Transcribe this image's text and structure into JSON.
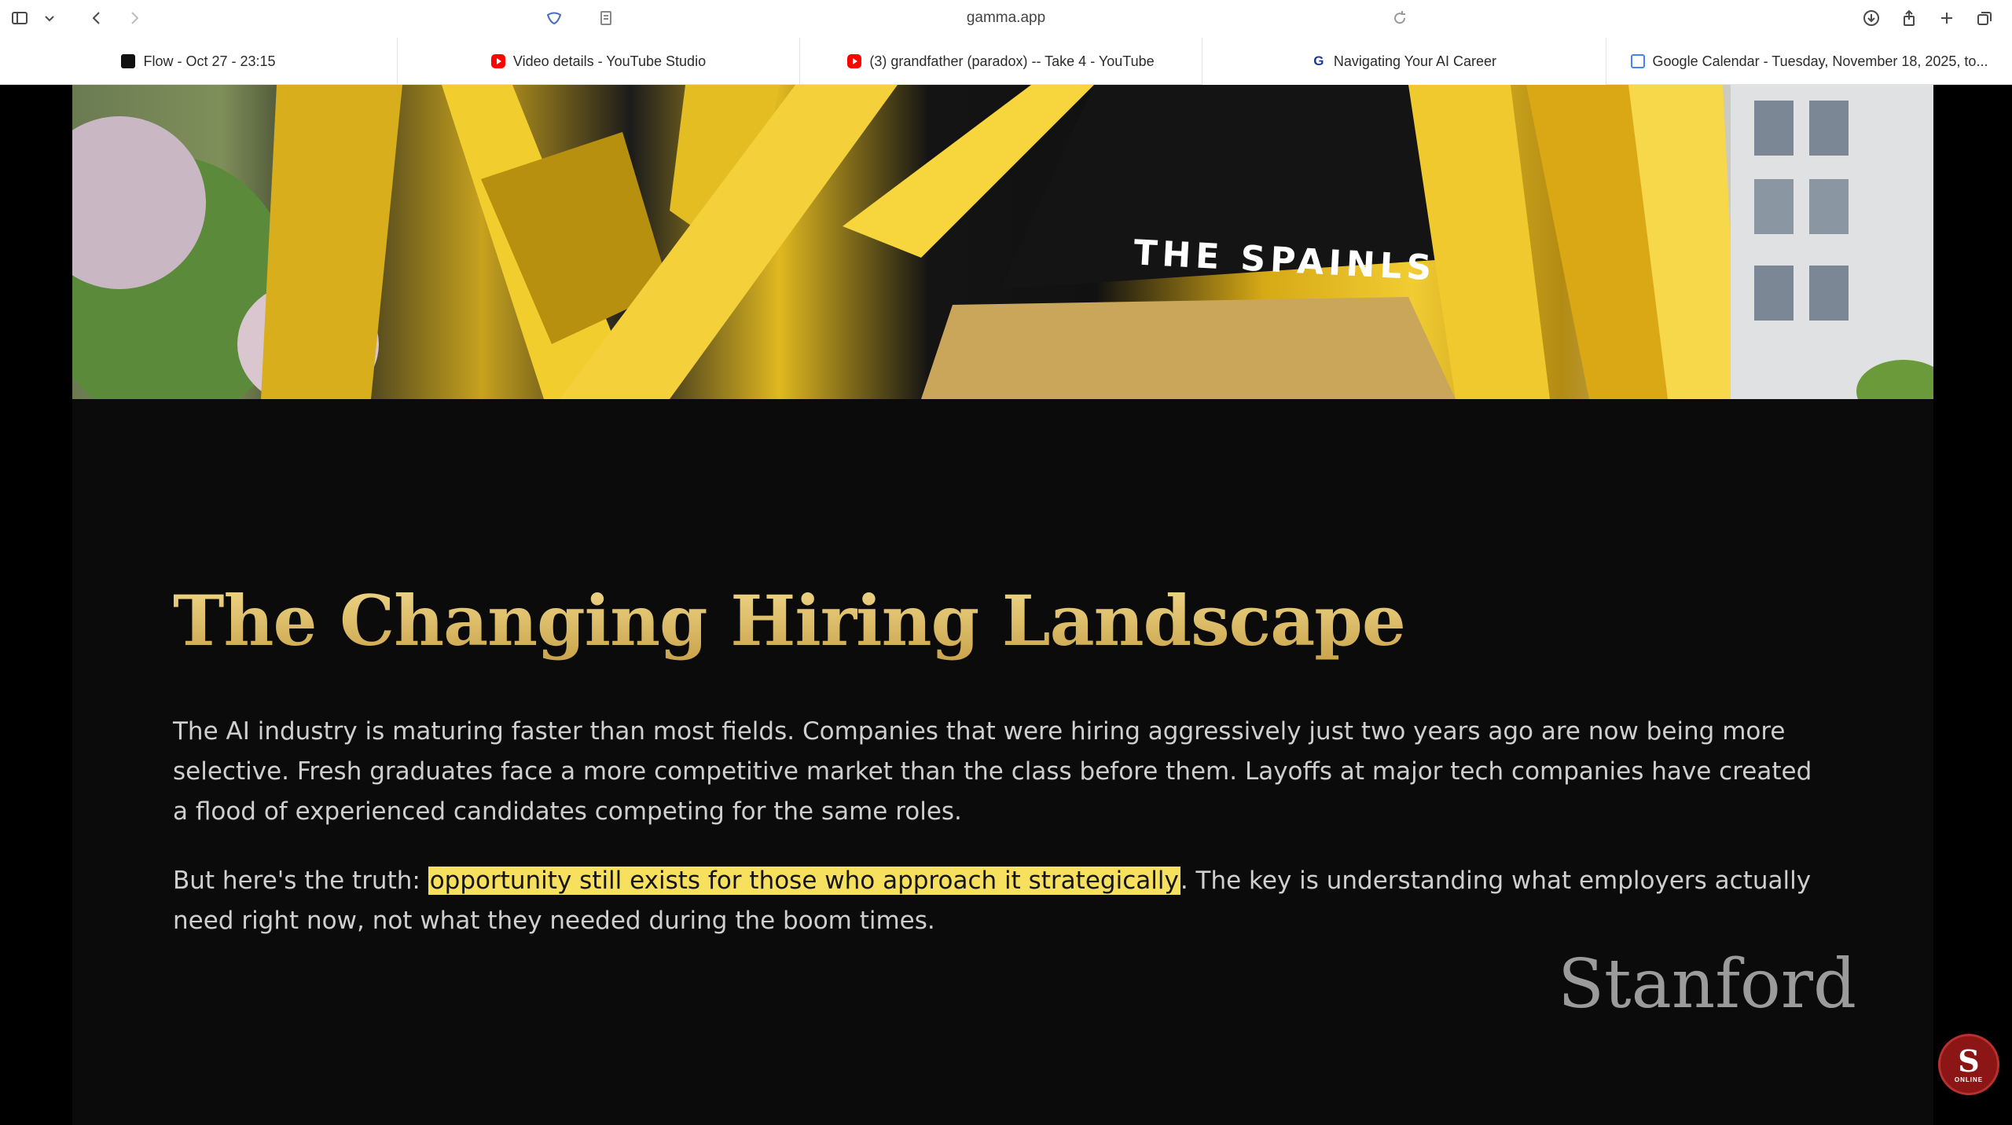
{
  "browser": {
    "url": "gamma.app",
    "tabs": [
      {
        "label": "Flow - Oct 27 - 23:15",
        "icon": "flow-icon"
      },
      {
        "label": "Video details - YouTube Studio",
        "icon": "youtube-icon"
      },
      {
        "label": "(3) grandfather (paradox) -- Take 4 - YouTube",
        "icon": "youtube-icon"
      },
      {
        "label": "Navigating Your AI Career",
        "icon": "gamma-icon",
        "active": true
      },
      {
        "label": "Google Calendar - Tuesday, November 18, 2025, to...",
        "icon": "calendar-icon"
      }
    ]
  },
  "hero": {
    "sign_text": "THE SPAINLS"
  },
  "slide": {
    "title": "The Changing Hiring Landscape",
    "para1": "The AI industry is maturing faster than most fields. Companies that were hiring aggressively just two years ago are now being more selective. Fresh graduates face a more competitive market than the class before them. Layoffs at major tech companies have created a flood of experienced candidates competing for the same roles.",
    "para2_before": "But here's the truth: ",
    "para2_highlight": "opportunity still exists for those who approach it strategically",
    "para2_after": ". The key is understanding what employers actually need right now, not what they needed during the boom times.",
    "brand": "Stanford"
  },
  "badge": {
    "letter": "S",
    "caption": "ONLINE"
  },
  "colors": {
    "title_gold": "#d9b85c",
    "highlight": "#f6e05e",
    "background": "#0b0b0b",
    "body_text": "#cfcfcf",
    "stanford_red": "#8c1515"
  }
}
